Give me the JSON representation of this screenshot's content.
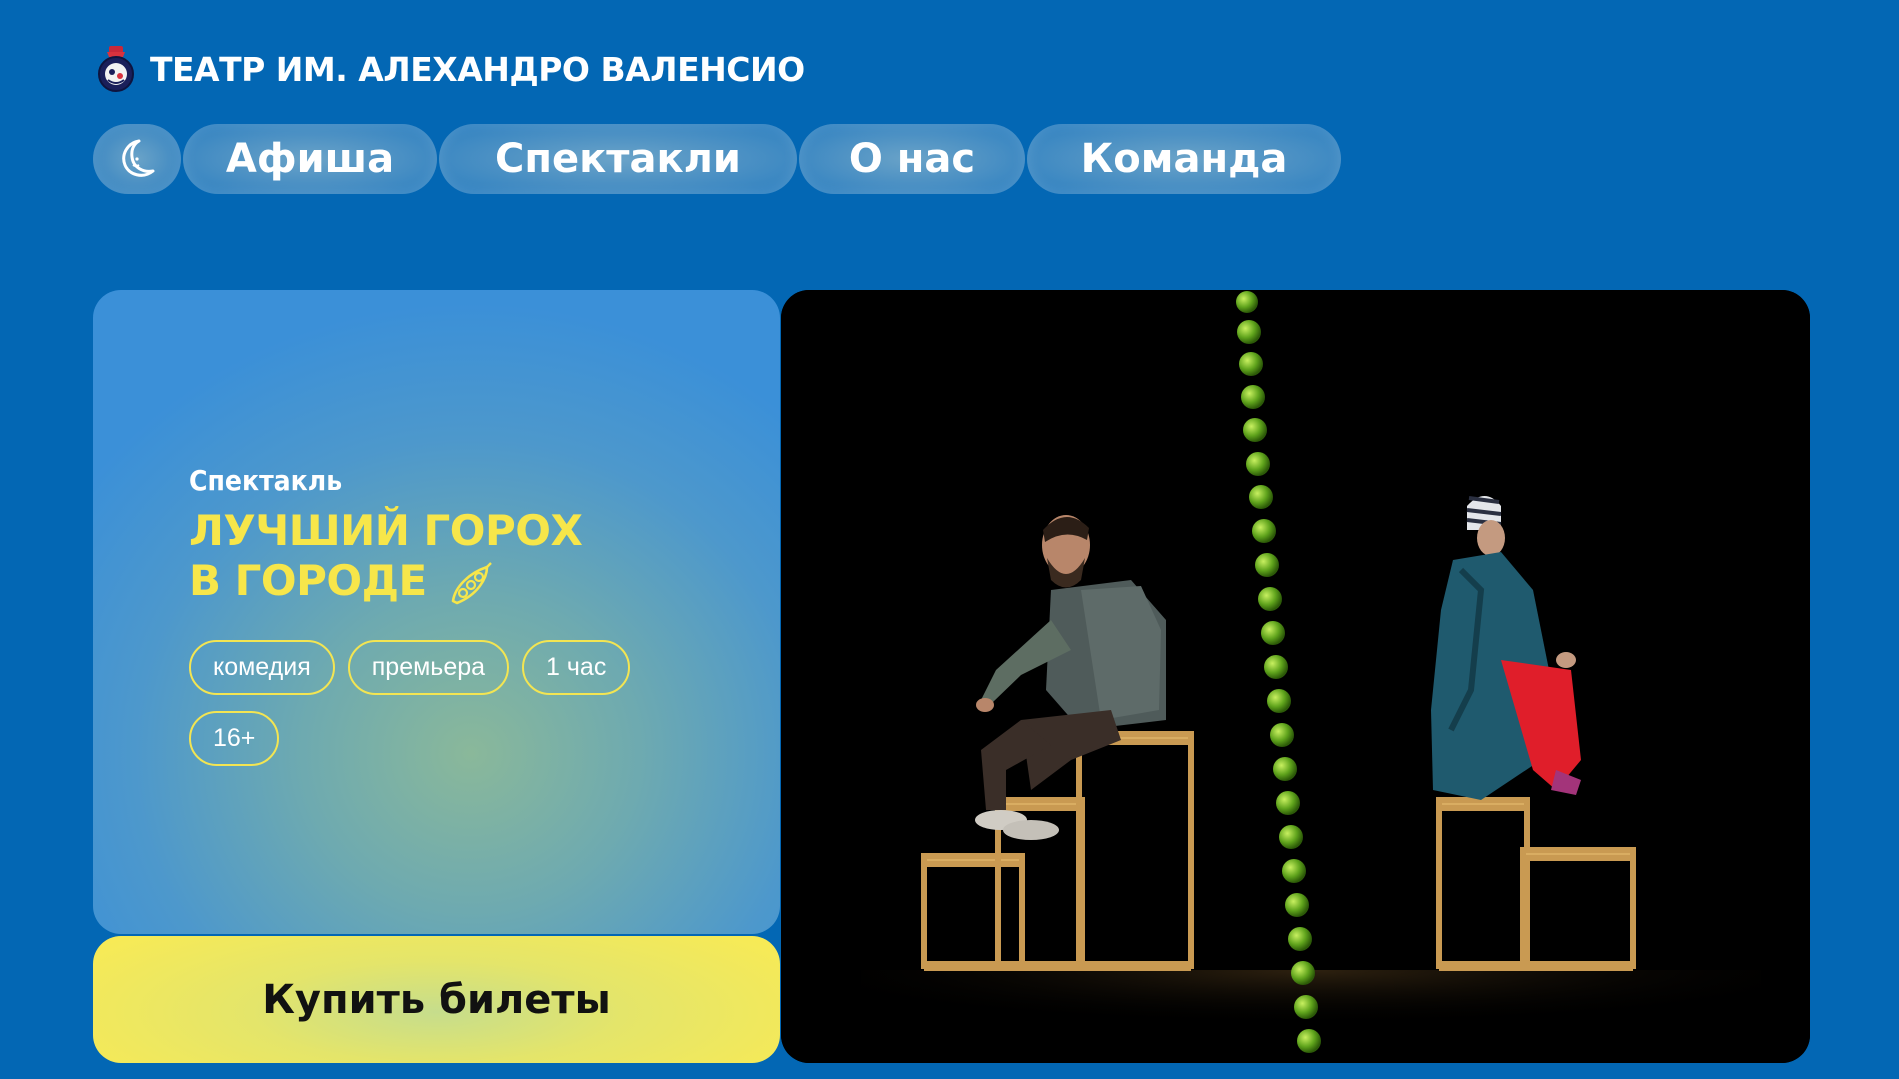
{
  "header": {
    "logo_icon": "theatre-crest-icon",
    "title": "ТЕАТР ИМ. АЛЕХАНДРО ВАЛЕНСИО"
  },
  "nav": {
    "theme_toggle_icon": "moon-icon",
    "items": [
      {
        "label": "Афиша"
      },
      {
        "label": "Спектакли"
      },
      {
        "label": "О нас"
      },
      {
        "label": "Команда"
      }
    ]
  },
  "show": {
    "kind": "Спектакль",
    "title_line1": "ЛУЧШИЙ ГОРОХ",
    "title_line2": "В ГОРОДЕ",
    "title_icon": "pea-pod-icon",
    "tags": [
      "комедия",
      "премьера",
      "1 час",
      "16+"
    ]
  },
  "cta": {
    "buy_label": "Купить билеты"
  },
  "photo": {
    "subject": "stage-photo"
  },
  "colors": {
    "background": "#0367b4",
    "accent_yellow": "#f7e64a",
    "photo_bg": "#000000"
  }
}
